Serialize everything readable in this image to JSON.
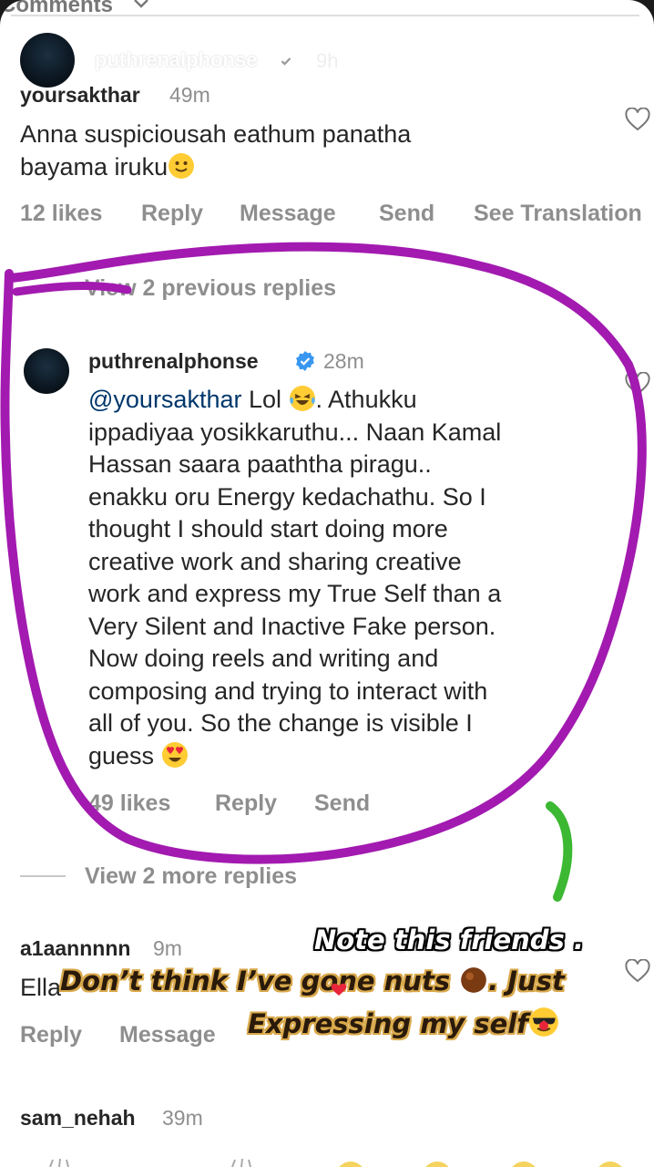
{
  "story_header": {
    "comments_label": "Comments",
    "username": "puthrenalphonse",
    "time": "9h"
  },
  "comment1": {
    "username": "yoursakthar",
    "time": "49m",
    "text_line1": "Anna suspiciousah eathum panatha",
    "text_line2": "bayama iruku",
    "likes": "12 likes",
    "reply": "Reply",
    "message": "Message",
    "send": "Send",
    "translation": "See Translation"
  },
  "view_previous": "View 2 previous replies",
  "reply1": {
    "username": "puthrenalphonse",
    "time": "28m",
    "mention": "@yoursakthar",
    "line1": " Lol ",
    "line1b": ". Athukku",
    "lines": [
      "ippadiyaa yosikkaruthu... Naan Kamal",
      "Hassan saara paaththa piragu..",
      "enakku oru Energy kedachathu. So I",
      "thought I should start doing more",
      "creative work and sharing creative",
      "work and express my True Self than a",
      "Very Silent and Inactive Fake person.",
      "Now doing reels and writing and",
      "composing and trying to interact with",
      "all of you. So the change is visible I"
    ],
    "last_line": "guess ",
    "likes": "49 likes",
    "reply": "Reply",
    "send": "Send"
  },
  "view_more": "View 2 more replies",
  "comment2": {
    "username": "a1aannnnn",
    "time": "9m",
    "text": "Ella",
    "reply": "Reply",
    "message": "Message"
  },
  "comment3": {
    "username": "sam_nehah",
    "time": "39m"
  },
  "overlay": {
    "line1": "Note this friends .",
    "line2a": "Don’t think I’ve gone nuts ",
    "line2b": ". Just",
    "line3": "Expressing my self"
  },
  "colors": {
    "circle": "#a21ab0",
    "green_stroke": "#3cb832",
    "verified": "#3897f0"
  }
}
